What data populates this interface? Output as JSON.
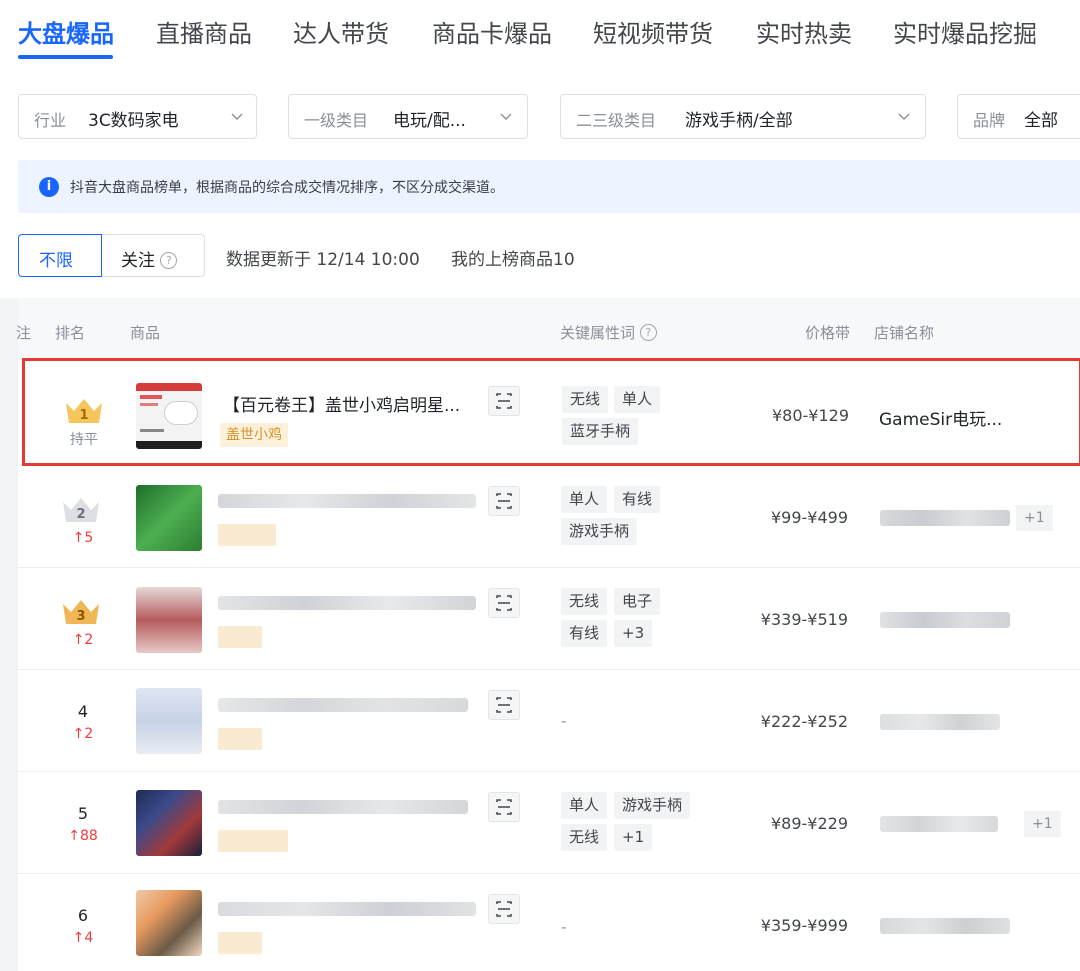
{
  "tabs": [
    {
      "label": "大盘爆品",
      "active": true
    },
    {
      "label": "直播商品"
    },
    {
      "label": "达人带货"
    },
    {
      "label": "商品卡爆品"
    },
    {
      "label": "短视频带货"
    },
    {
      "label": "实时热卖"
    },
    {
      "label": "实时爆品挖掘"
    }
  ],
  "filters": {
    "industry": {
      "label": "行业",
      "value": "3C数码家电"
    },
    "level1": {
      "label": "一级类目",
      "value": "电玩/配..."
    },
    "level23": {
      "label": "二三级类目",
      "value": "游戏手柄/全部"
    },
    "brand": {
      "label": "品牌",
      "value": "全部"
    }
  },
  "info": {
    "text": "抖音大盘商品榜单，根据商品的综合成交情况排序，不区分成交渠道。",
    "icon": "info-icon"
  },
  "toggle": {
    "unlimited": "不限",
    "follow": "关注"
  },
  "update_text": "数据更新于 12/14 10:00",
  "mine_text": "我的上榜商品10",
  "table": {
    "headers": {
      "edge": "注",
      "rank": "排名",
      "product": "商品",
      "keywords": "关键属性词",
      "price": "价格带",
      "shop": "店铺名称"
    },
    "rows": [
      {
        "rank": "1",
        "trend": "持平",
        "trend_type": "flat",
        "title": "【百元卷王】盖世小鸡启明星...",
        "brand": "盖世小鸡",
        "keywords": [
          "无线",
          "单人",
          "蓝牙手柄"
        ],
        "price": "¥80-¥129",
        "shop": "GameSir电玩..."
      },
      {
        "rank": "2",
        "trend": "↑5",
        "trend_type": "up",
        "keywords": [
          "单人",
          "有线",
          "游戏手柄"
        ],
        "price": "¥99-¥499",
        "shop_extra": "+1"
      },
      {
        "rank": "3",
        "trend": "↑2",
        "trend_type": "up",
        "keywords": [
          "无线",
          "电子",
          "有线",
          "+3"
        ],
        "price": "¥339-¥519"
      },
      {
        "rank": "4",
        "trend": "↑2",
        "trend_type": "up",
        "keywords_empty": "-",
        "price": "¥222-¥252"
      },
      {
        "rank": "5",
        "trend": "↑88",
        "trend_type": "up",
        "keywords": [
          "单人",
          "游戏手柄",
          "无线",
          "+1"
        ],
        "price": "¥89-¥229",
        "shop_extra": "+1"
      },
      {
        "rank": "6",
        "trend": "↑4",
        "trend_type": "up",
        "keywords_empty": "-",
        "price": "¥359-¥999"
      }
    ]
  },
  "colors": {
    "accent": "#1966ff",
    "highlight_border": "#e53935",
    "trend_up": "#f23c3c",
    "brand_tag_bg": "#fdf1dc",
    "brand_tag_text": "#d6942b"
  }
}
